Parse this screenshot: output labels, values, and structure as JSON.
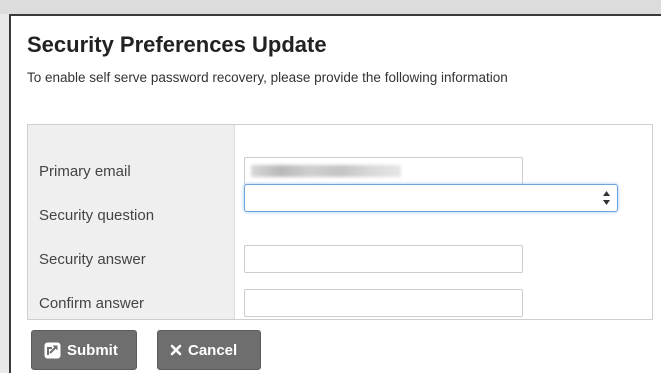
{
  "dialog": {
    "title": "Security Preferences Update",
    "subtitle": "To enable self serve password recovery, please provide the following information"
  },
  "form": {
    "primary_email": {
      "label": "Primary email",
      "value": ""
    },
    "security_question": {
      "label": "Security question",
      "selected": ""
    },
    "security_answer": {
      "label": "Security answer",
      "value": ""
    },
    "confirm_answer": {
      "label": "Confirm answer",
      "value": ""
    }
  },
  "buttons": {
    "submit_label": "Submit",
    "submit_icon": "external-link-square-icon",
    "cancel_label": "Cancel",
    "cancel_icon": "close-icon"
  },
  "colors": {
    "button_bg": "#6e6e6e",
    "focus_border": "#6fa3de",
    "label_column_bg": "#efefef"
  }
}
